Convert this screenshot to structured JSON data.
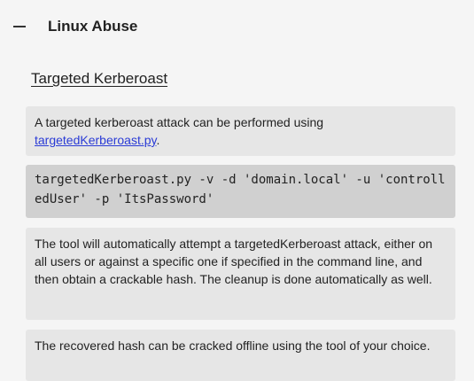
{
  "section": {
    "title": "Linux Abuse"
  },
  "subheading": "Targeted Kerberoast",
  "cards": {
    "intro_text": "A targeted kerberoast attack can be performed using ",
    "intro_link": "targetedKerberoast.py",
    "intro_end": ".",
    "code": "targetedKerberoast.py -v -d 'domain.local' -u 'controlledUser' -p 'ItsPassword'",
    "description": "The tool will automatically attempt a targetedKerberoast attack, either on all users or against a specific one if specified in the command line, and then obtain a crackable hash. The cleanup is done automatically as well.",
    "recovered": "The recovered hash can be cracked offline using the tool of your choice."
  }
}
